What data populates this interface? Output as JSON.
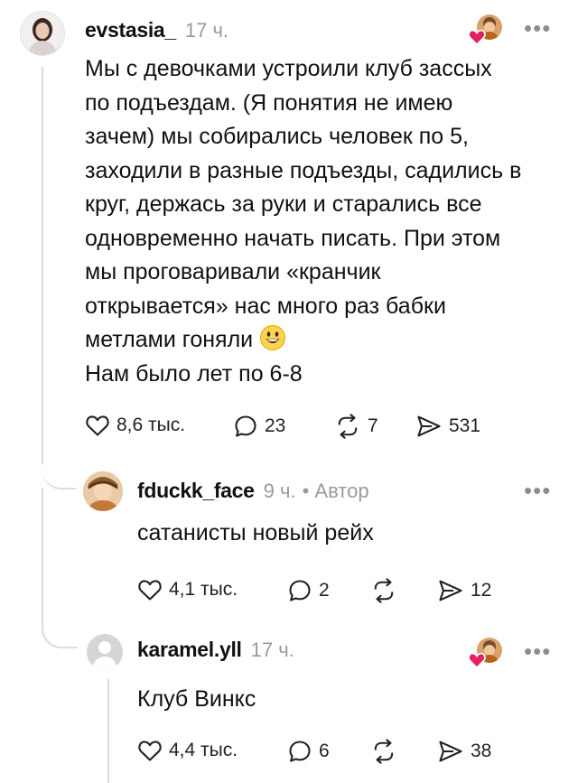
{
  "post": {
    "username": "evstasia_",
    "time": "17 ч.",
    "lines": [
      "Мы с девочками устроили клуб зассых",
      "по подъездам. (Я понятия не имею",
      "зачем) мы собирались человек по 5,",
      "заходили в разные подъезды, садились в",
      "круг, держась за руки и старались все",
      "одновременно начать писать. При этом",
      "мы проговаривали «кранчик",
      "открывается» нас много раз бабки",
      "метлами гоняли",
      "Нам было лет по 6-8"
    ],
    "likes": "8,6 тыс.",
    "comments": "23",
    "reposts": "7",
    "shares": "531"
  },
  "reply1": {
    "username": "fduckk_face",
    "time": "9 ч.",
    "author_tag": "• Автор",
    "text": "сатанисты новый рейх",
    "likes": "4,1 тыс.",
    "comments": "2",
    "shares": "12"
  },
  "reply2": {
    "username": "karamel.yll",
    "time": "17 ч.",
    "text": "Клуб Винкс",
    "likes": "4,4 тыс.",
    "comments": "6",
    "shares": "38"
  },
  "icons": {
    "more": "•••",
    "like": "heart-icon",
    "comment": "comment-bubble-icon",
    "repost": "repost-icon",
    "share": "send-icon",
    "emoji": "grinning-face-emoji"
  },
  "colors": {
    "liked_heart": "#e0245e",
    "muted": "#9a9a9a",
    "thread_line": "#dcdcdc"
  }
}
